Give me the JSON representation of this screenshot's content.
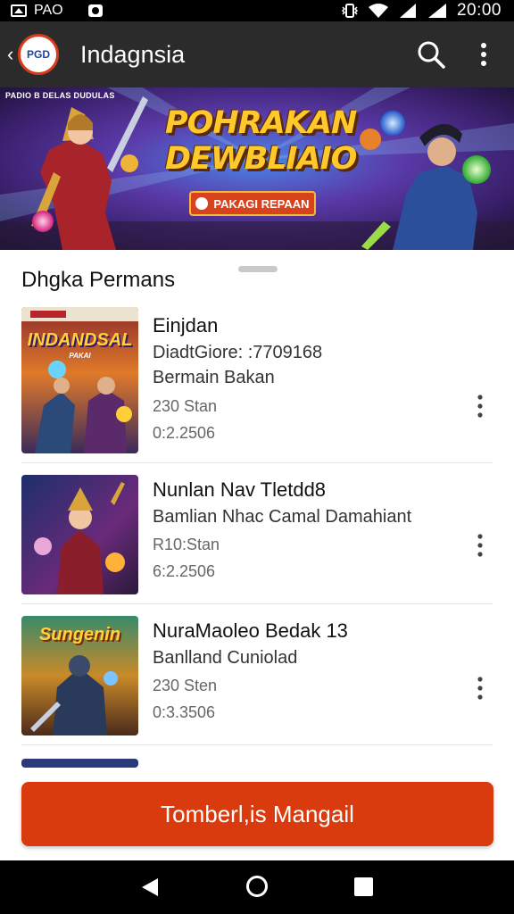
{
  "status_bar": {
    "left_text": "PAO",
    "time": "20:00"
  },
  "app_bar": {
    "logo_text": "PGD",
    "title": "Indagnsia"
  },
  "banner": {
    "caption": "PADIO B DELAS DUDULAS",
    "title_line1": "POHRAKAN",
    "title_line2": "DEWBLIAIO",
    "pill_text": "PAKAGI REPAAN"
  },
  "section": {
    "title": "Dhgka Permans"
  },
  "items": [
    {
      "title": "Einjdan",
      "subtitle": "DiadtGiore: :7709168",
      "subtitle2": "Bermain Bakan",
      "meta1": "230 Stan",
      "meta2": "0:2.2506",
      "thumb_text": "INDANDSAL",
      "thumb_tag": "PAKAI"
    },
    {
      "title": "Nunlan Nav Tletdd8",
      "subtitle": "Bamlian Nhac Camal Damahiant",
      "meta1": "R10:Stan",
      "meta2": "6:2.2506"
    },
    {
      "title": "NuraMaoleo Bedak 13",
      "subtitle": "Banlland Cuniolad",
      "meta1": "230 Sten",
      "meta2": "0:3.3506",
      "thumb_text": "Sungenin"
    }
  ],
  "cta": {
    "label": "Tomberl,is Mangail"
  },
  "colors": {
    "accent": "#d93a0e",
    "app_bar": "#2b2b2b",
    "title_gold": "#ffc82b"
  }
}
